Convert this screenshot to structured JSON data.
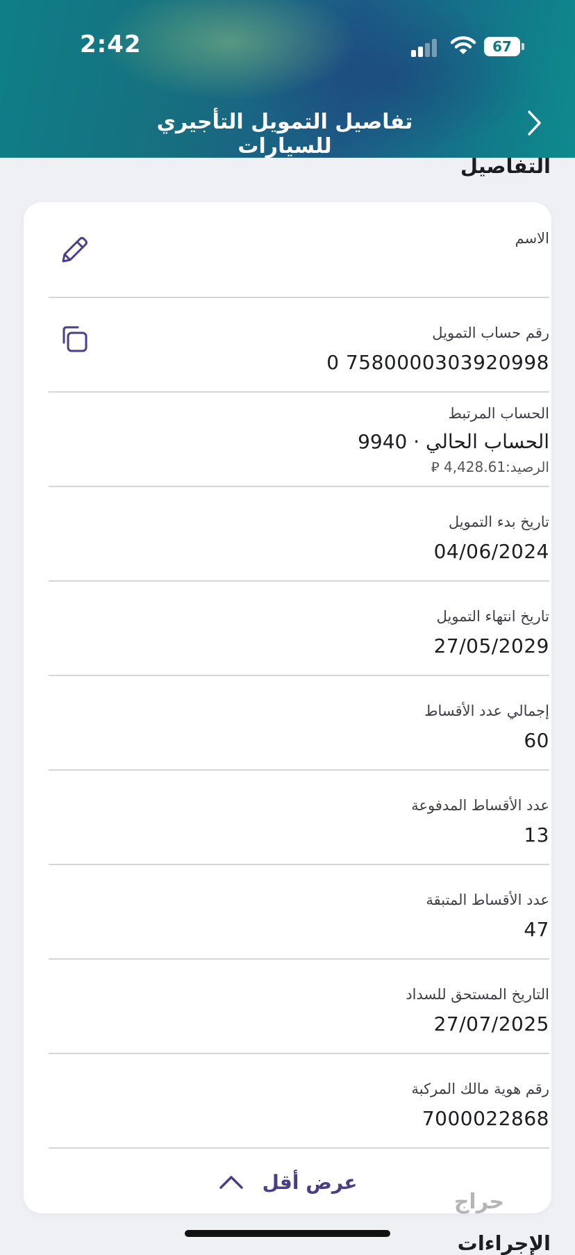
{
  "status_bar": {
    "time": "2:42",
    "battery": "67"
  },
  "header": {
    "title": "تفاصيل التمويل التأجيري للسيارات"
  },
  "section": {
    "title": "التفاصيل"
  },
  "rows": [
    {
      "label": "الاسم",
      "value": ""
    },
    {
      "label": "رقم حساب التمويل",
      "value": "7580000303920998 0"
    },
    {
      "label": "الحساب المرتبط",
      "value": "الحساب الحالي · 9940",
      "sub": "الرصيد:4,428.61 ⃁"
    },
    {
      "label": "تاريخ بدء التمويل",
      "value": "04/06/2024"
    },
    {
      "label": "تاريخ انتهاء التمويل",
      "value": "27/05/2029"
    },
    {
      "label": "إجمالي عدد الأقساط",
      "value": "60"
    },
    {
      "label": "عدد الأقساط المدفوعة",
      "value": "13"
    },
    {
      "label": "عدد الأقساط المتبقة",
      "value": "47"
    },
    {
      "label": "التاريخ المستحق للسداد",
      "value": "27/07/2025"
    },
    {
      "label": "رقم هوية مالك المركبة",
      "value": "7000022868"
    }
  ],
  "show_less": {
    "label": "عرض أقل"
  },
  "next_section": {
    "title": "الإجراءات"
  },
  "watermark": {
    "text": "حراج"
  },
  "colors": {
    "accent": "#4a3f86",
    "header_teal": "#137783"
  }
}
